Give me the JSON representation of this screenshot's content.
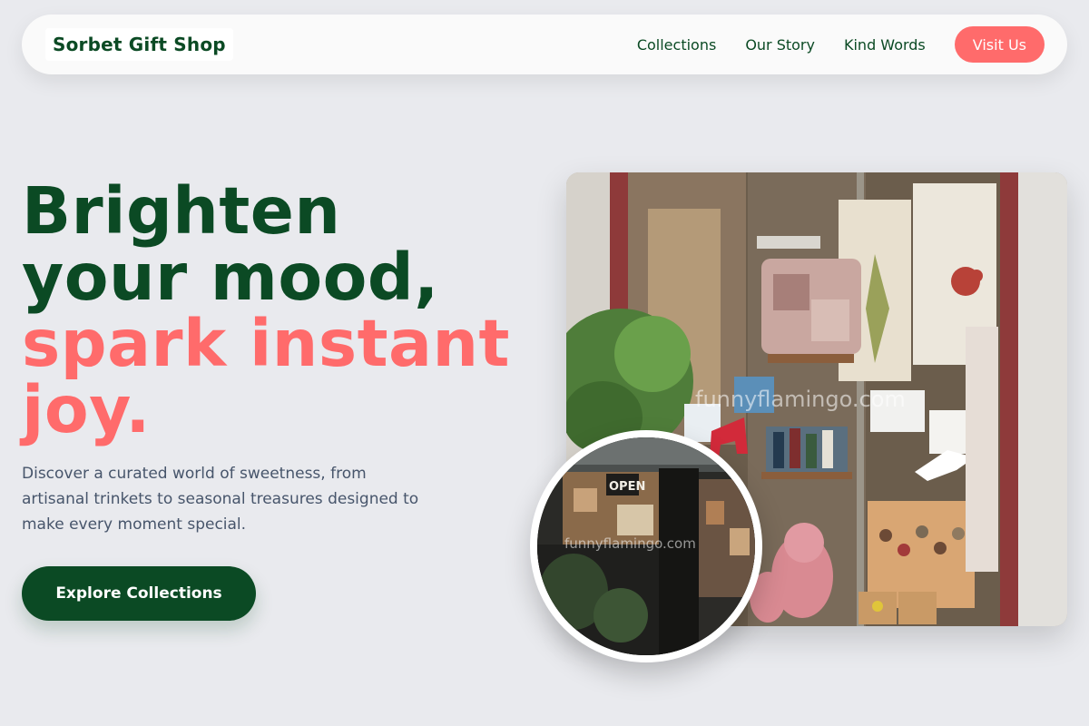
{
  "nav": {
    "logo": "Sorbet Gift Shop",
    "links": [
      "Collections",
      "Our Story",
      "Kind Words"
    ],
    "cta": "Visit Us"
  },
  "hero": {
    "headline_line1": "Brighten",
    "headline_line2": "your mood,",
    "headline_line3": "spark instant",
    "headline_line4": "joy.",
    "subtext": "Discover a curated world of sweetness, from artisanal trinkets to seasonal treasures designed to make every moment special.",
    "cta": "Explore Collections"
  },
  "images": {
    "main_watermark": "funnyflamingo.com",
    "inset_watermark": "funnyflamingo.com",
    "inset_sign": "OPEN"
  },
  "colors": {
    "background": "#e9eaee",
    "brand_green": "#0b4a24",
    "accent_coral": "#ff6b6b",
    "body_text": "#47556b"
  }
}
